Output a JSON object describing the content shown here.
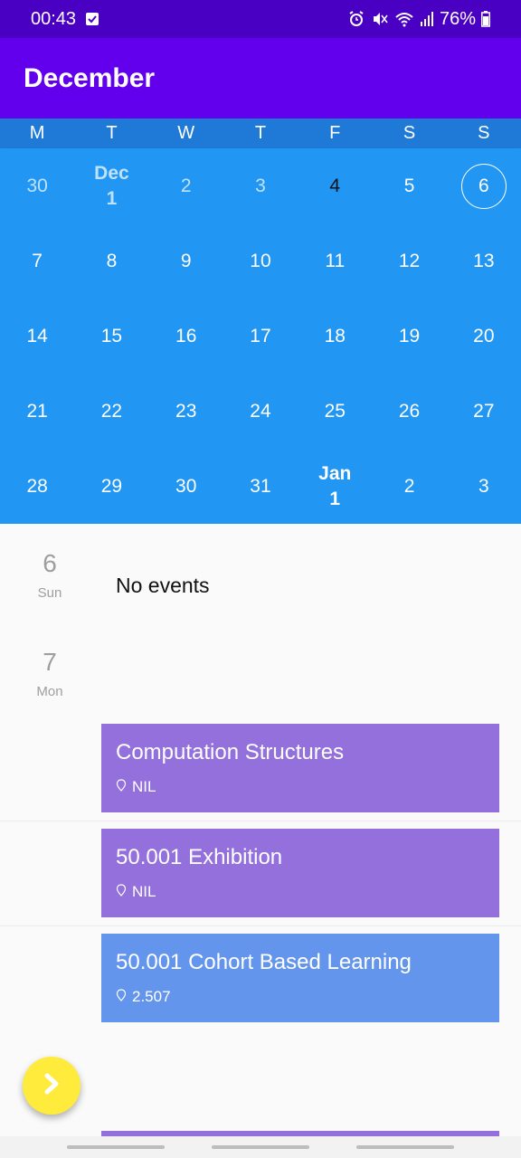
{
  "status_bar": {
    "time": "00:43",
    "battery": "76%",
    "icons": [
      "notification-check-icon",
      "alarm-icon",
      "mute-icon",
      "wifi-icon",
      "signal-icon",
      "battery-icon"
    ]
  },
  "app_bar": {
    "title": "December"
  },
  "calendar": {
    "weekdays": [
      "M",
      "T",
      "W",
      "T",
      "F",
      "S",
      "S"
    ],
    "weeks": [
      [
        {
          "label": "30",
          "style": "other"
        },
        {
          "label": "Dec\n1",
          "style": "other bold"
        },
        {
          "label": "2",
          "style": "other"
        },
        {
          "label": "3",
          "style": "other"
        },
        {
          "label": "4",
          "style": "dark"
        },
        {
          "label": "5",
          "style": ""
        },
        {
          "label": "6",
          "style": "sel"
        }
      ],
      [
        {
          "label": "7",
          "style": ""
        },
        {
          "label": "8",
          "style": ""
        },
        {
          "label": "9",
          "style": ""
        },
        {
          "label": "10",
          "style": ""
        },
        {
          "label": "11",
          "style": ""
        },
        {
          "label": "12",
          "style": ""
        },
        {
          "label": "13",
          "style": ""
        }
      ],
      [
        {
          "label": "14",
          "style": ""
        },
        {
          "label": "15",
          "style": ""
        },
        {
          "label": "16",
          "style": ""
        },
        {
          "label": "17",
          "style": ""
        },
        {
          "label": "18",
          "style": ""
        },
        {
          "label": "19",
          "style": ""
        },
        {
          "label": "20",
          "style": ""
        }
      ],
      [
        {
          "label": "21",
          "style": ""
        },
        {
          "label": "22",
          "style": ""
        },
        {
          "label": "23",
          "style": ""
        },
        {
          "label": "24",
          "style": ""
        },
        {
          "label": "25",
          "style": ""
        },
        {
          "label": "26",
          "style": ""
        },
        {
          "label": "27",
          "style": ""
        }
      ],
      [
        {
          "label": "28",
          "style": ""
        },
        {
          "label": "29",
          "style": ""
        },
        {
          "label": "30",
          "style": ""
        },
        {
          "label": "31",
          "style": ""
        },
        {
          "label": "Jan\n1",
          "style": "bold"
        },
        {
          "label": "2",
          "style": ""
        },
        {
          "label": "3",
          "style": ""
        }
      ]
    ]
  },
  "agenda": {
    "days": [
      {
        "num": "6",
        "name": "Sun",
        "empty_text": "No events"
      },
      {
        "num": "7",
        "name": "Mon"
      }
    ],
    "events": [
      {
        "title": "Computation Structures",
        "location": "NIL",
        "color": "#9370db"
      },
      {
        "title": "50.001 Exhibition",
        "location": "NIL",
        "color": "#9370db"
      },
      {
        "title": "50.001 Cohort Based Learning",
        "location": "2.507",
        "color": "#6495ed"
      }
    ]
  },
  "fab": {
    "icon": "chevron-right-icon",
    "color": "#ffeb3b"
  },
  "colors": {
    "status_bar": "#4a00c2",
    "app_bar": "#6200ee",
    "weekday_bar": "#1e7ad6",
    "calendar": "#2196f3"
  }
}
